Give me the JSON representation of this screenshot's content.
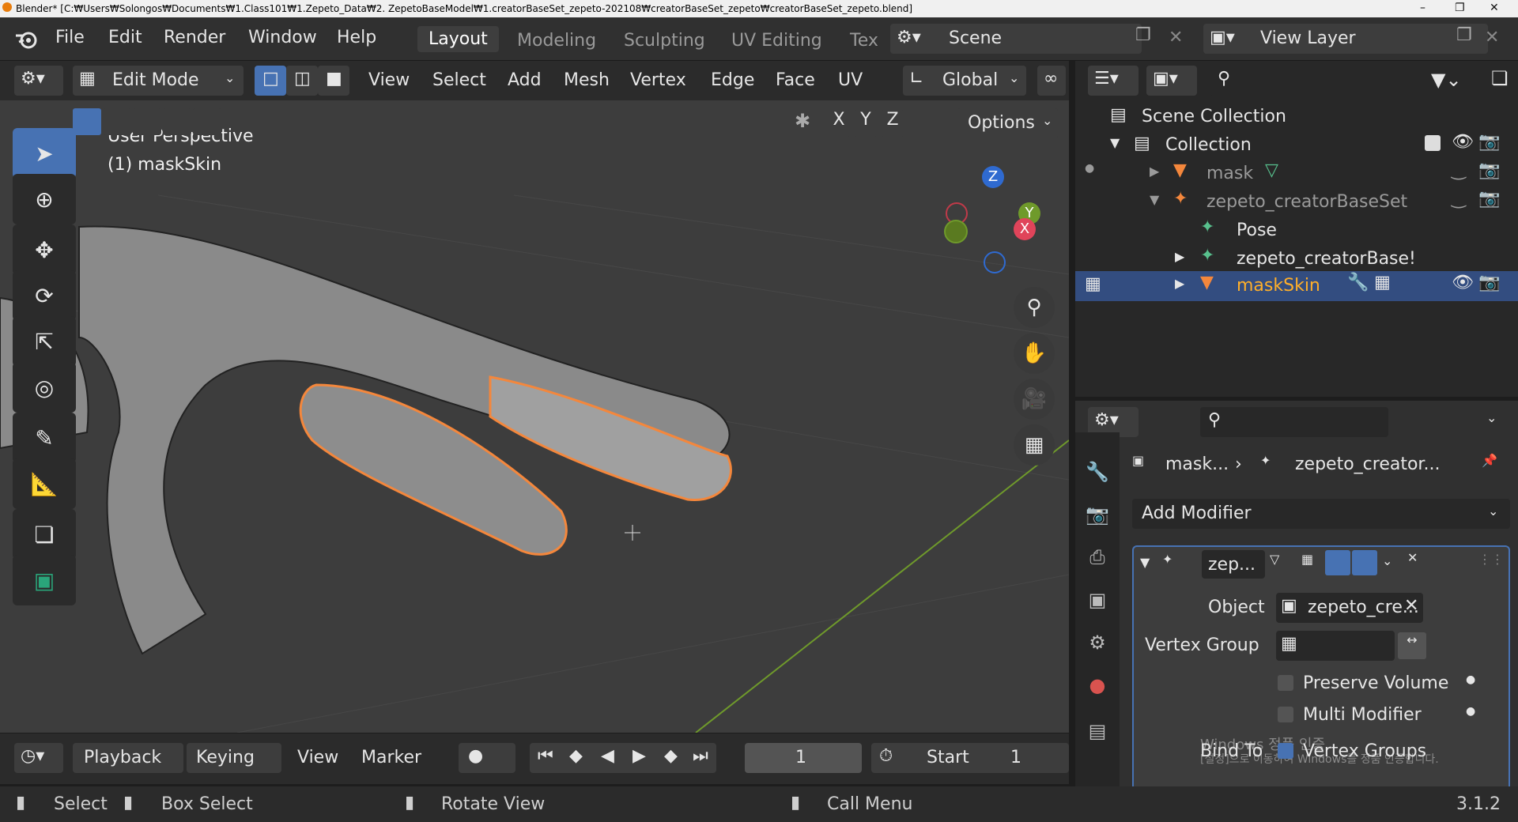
{
  "window": {
    "title": "Blender* [C:₩Users₩Solongos₩Documents₩1.Class101₩1.Zepeto_Data₩2. ZepetoBaseModel₩1.creatorBaseSet_zepeto-202108₩creatorBaseSet_zepeto₩creatorBaseSet_zepeto.blend]",
    "minimize": "–",
    "maximize": "❐",
    "close": "✕"
  },
  "menu": {
    "file": "File",
    "edit": "Edit",
    "render": "Render",
    "window": "Window",
    "help": "Help"
  },
  "workspaces": [
    "Layout",
    "Modeling",
    "Sculpting",
    "UV Editing",
    "Tex"
  ],
  "scene": {
    "name": "Scene",
    "view_layer": "View Layer"
  },
  "viewport_header": {
    "mode": "Edit Mode",
    "menus": [
      "View",
      "Select",
      "Add",
      "Mesh",
      "Vertex",
      "Edge",
      "Face",
      "UV"
    ],
    "orientation": "Global",
    "axes": [
      "X",
      "Y",
      "Z"
    ],
    "options": "Options"
  },
  "viewport": {
    "perspective": "User Perspective",
    "object": "(1) maskSkin",
    "gizmo": {
      "z": "Z",
      "y": "Y",
      "x": "X"
    }
  },
  "timeline": {
    "playback": "Playback",
    "keying": "Keying",
    "view": "View",
    "marker": "Marker",
    "current_frame": "1",
    "start_label": "Start",
    "start_value": "1"
  },
  "statusbar": {
    "select": "Select",
    "box_select": "Box Select",
    "rotate_view": "Rotate View",
    "call_menu": "Call Menu",
    "version": "3.1.2"
  },
  "outliner": {
    "items": [
      {
        "label": "Scene Collection"
      },
      {
        "label": "Collection"
      },
      {
        "label": "mask"
      },
      {
        "label": "zepeto_creatorBaseSet"
      },
      {
        "label": "Pose"
      },
      {
        "label": "zepeto_creatorBase!"
      },
      {
        "label": "maskSkin"
      }
    ]
  },
  "properties": {
    "breadcrumb_object": "mask...",
    "breadcrumb_modifier": "zepeto_creator...",
    "add_modifier": "Add Modifier",
    "modifier_name": "zep...",
    "object_label": "Object",
    "object_value": "zepeto_cre...",
    "vertex_group_label": "Vertex Group",
    "preserve_volume": "Preserve Volume",
    "multi_modifier": "Multi Modifier",
    "bind_to": "Bind To",
    "vertex_groups": "Vertex Groups",
    "watermark_line1": "Windows 정품 인증",
    "watermark_line2": "[설정]으로 이동하여 Windows를 정품 인증합니다."
  },
  "colors": {
    "accent": "#4772b3",
    "selection": "#f4873c",
    "header": "#303030"
  }
}
